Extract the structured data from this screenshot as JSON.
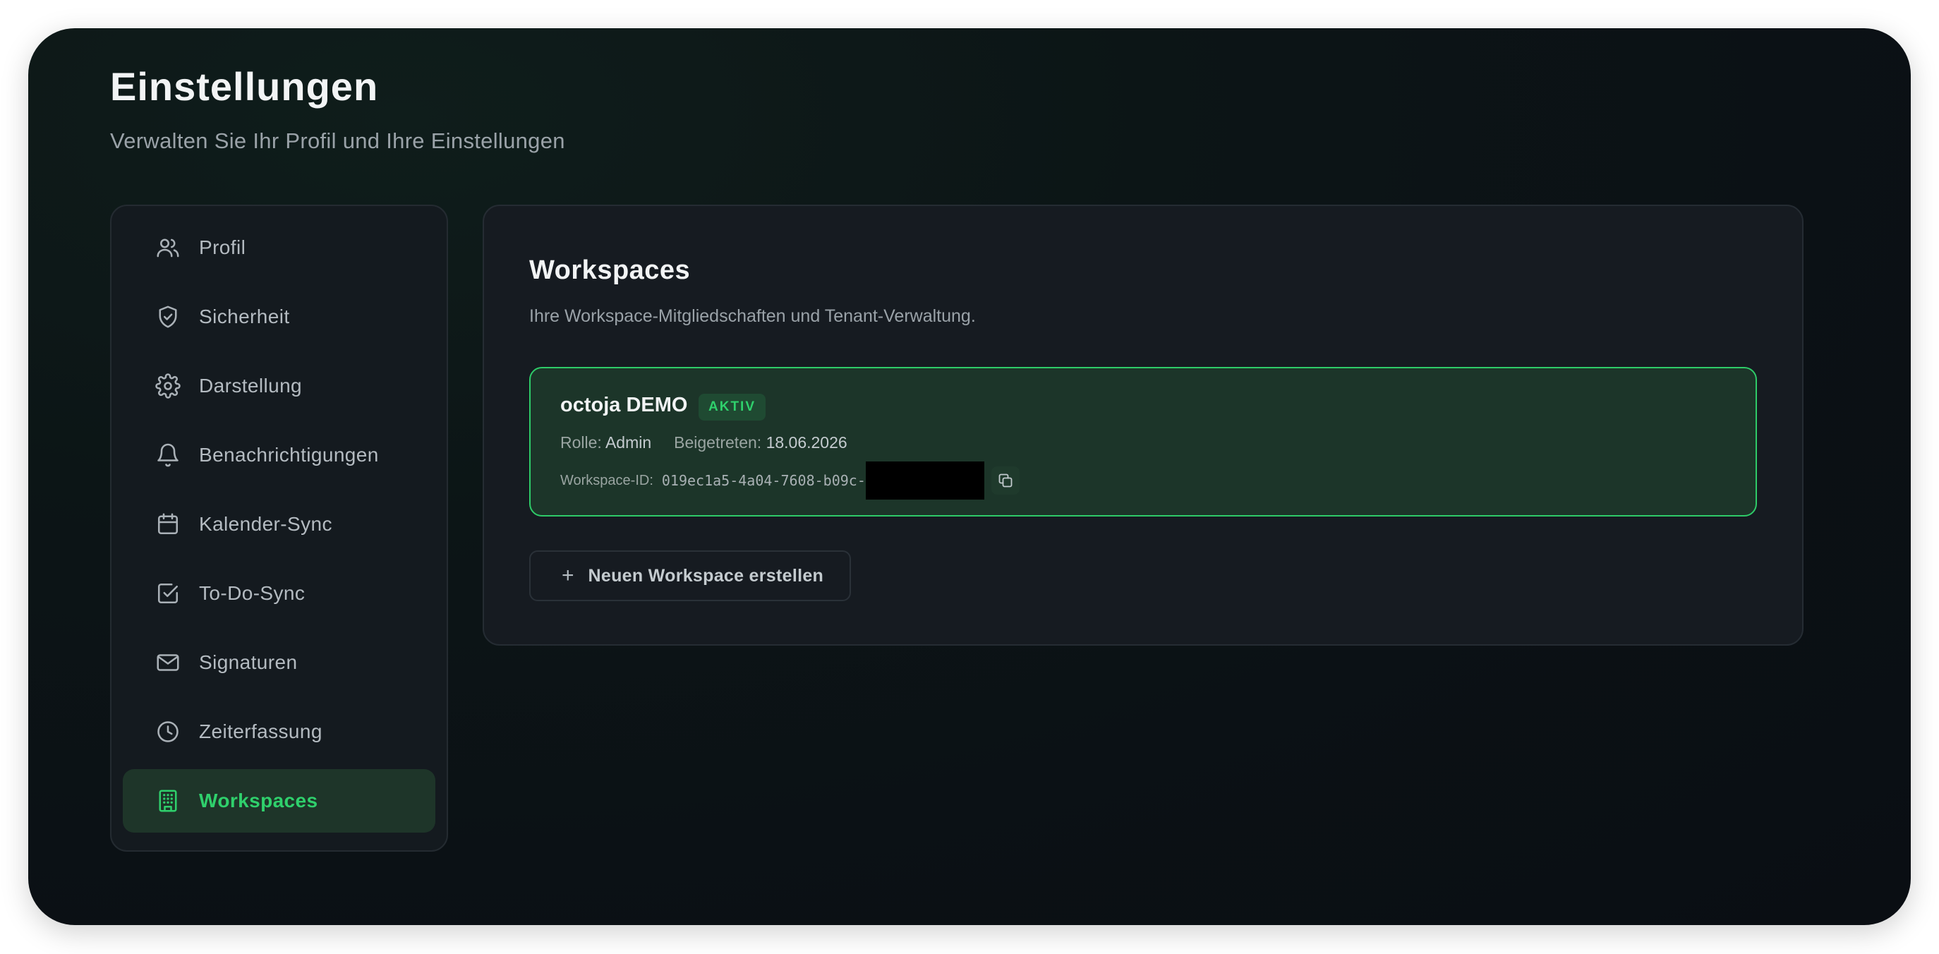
{
  "header": {
    "title": "Einstellungen",
    "subtitle": "Verwalten Sie Ihr Profil und Ihre Einstellungen"
  },
  "sidebar": {
    "items": [
      {
        "label": "Profil",
        "icon": "users-icon",
        "active": false
      },
      {
        "label": "Sicherheit",
        "icon": "shield-icon",
        "active": false
      },
      {
        "label": "Darstellung",
        "icon": "gear-icon",
        "active": false
      },
      {
        "label": "Benachrichtigungen",
        "icon": "bell-icon",
        "active": false
      },
      {
        "label": "Kalender-Sync",
        "icon": "calendar-icon",
        "active": false
      },
      {
        "label": "To-Do-Sync",
        "icon": "checkbox-icon",
        "active": false
      },
      {
        "label": "Signaturen",
        "icon": "mail-icon",
        "active": false
      },
      {
        "label": "Zeiterfassung",
        "icon": "clock-icon",
        "active": false
      },
      {
        "label": "Workspaces",
        "icon": "building-icon",
        "active": true
      }
    ]
  },
  "main": {
    "title": "Workspaces",
    "description": "Ihre Workspace-Mitgliedschaften und Tenant-Verwaltung.",
    "workspace": {
      "name": "octoja DEMO",
      "status_badge": "AKTIV",
      "role_label": "Rolle:",
      "role_value": "Admin",
      "joined_label": "Beigetreten:",
      "joined_value": "18.06.2026",
      "id_label": "Workspace-ID:",
      "id_value": "019ec1a5-4a04-7608-b09c-"
    },
    "new_workspace_button": "Neuen Workspace erstellen"
  },
  "colors": {
    "accent": "#2fd06c",
    "background": "#0b1115",
    "card_active": "#1c3529"
  }
}
